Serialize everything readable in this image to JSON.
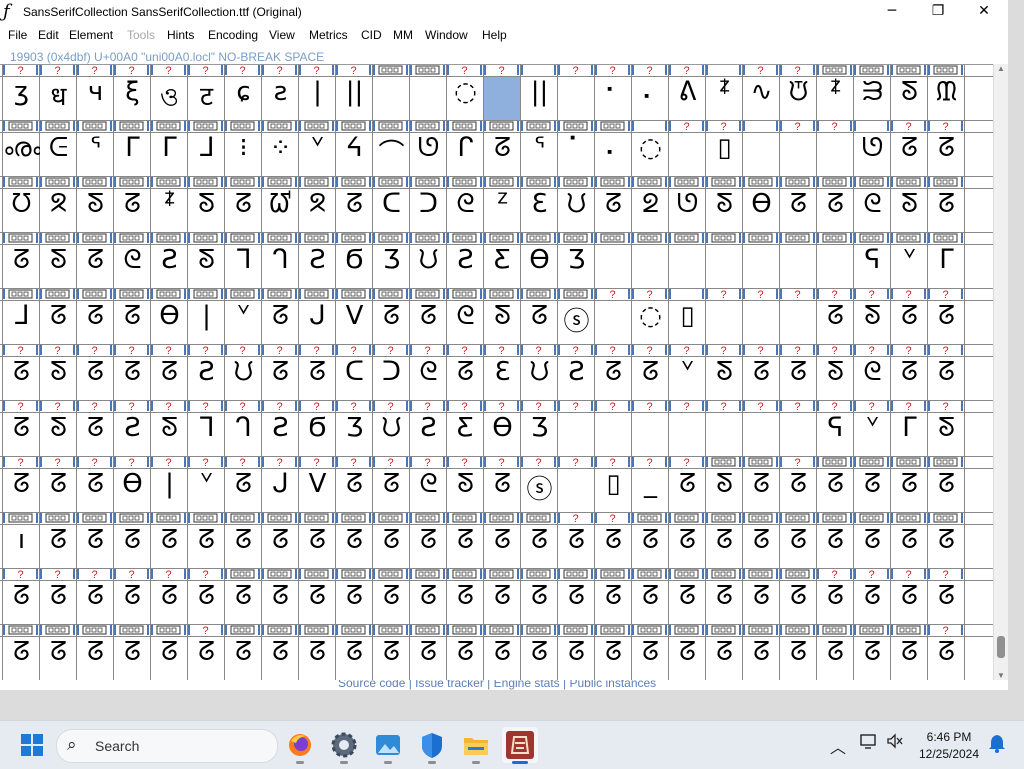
{
  "window": {
    "title": "SansSerifCollection  SansSerifCollection.ttf (Original)",
    "app_icon": "ƒ",
    "controls": {
      "minimize": "─",
      "maximize": "❐",
      "close": "✕"
    }
  },
  "menubar": [
    {
      "label": "File",
      "enabled": true
    },
    {
      "label": "Edit",
      "enabled": true
    },
    {
      "label": "Element",
      "enabled": true
    },
    {
      "label": "Tools",
      "enabled": false
    },
    {
      "label": "Hints",
      "enabled": true
    },
    {
      "label": "Encoding",
      "enabled": true
    },
    {
      "label": "View",
      "enabled": true
    },
    {
      "label": "Metrics",
      "enabled": true
    },
    {
      "label": "CID",
      "enabled": true
    },
    {
      "label": "MM",
      "enabled": true
    },
    {
      "label": "Window",
      "enabled": true
    },
    {
      "label": "Help",
      "enabled": true
    }
  ],
  "info_line": "19903 (0x4dbf) U+00A0 \"uni00A0.locl\" NO-BREAK SPACE",
  "glyph_grid": {
    "columns": 26,
    "selected_cell": {
      "row": 0,
      "col": 13
    },
    "rows": [
      {
        "labels": "??????????□□?? ???? ??□□□□□□□□□□□□□",
        "glyphs": [
          "ʒ",
          "ध",
          "ч",
          "ξ",
          "ও",
          "ट",
          "ɕ",
          "ƨ",
          "|",
          "||",
          "",
          "",
          "◌",
          "",
          "||",
          "",
          "⠂",
          "⠄",
          "ᕕ",
          "ᙇ",
          "∿",
          "ᙈ",
          "ᙇ",
          "ᙐ",
          "ᘕ",
          "ᙢ"
        ]
      },
      {
        "labels": "□□□□□□□□□□□□□□□□□ ?? ?? ???? □□□",
        "glyphs": [
          "ൟ",
          "ᕮ",
          "ᕐ",
          "ᒥ",
          "ᒥ",
          "ᒧ",
          "⁝",
          "⁘",
          "ᘁ",
          "ᔦ",
          "⌒",
          "ᘎ",
          "ᒋ",
          "ᘔ",
          "ᕐ",
          "⠁",
          "⠄",
          "◌",
          "",
          "▯",
          "",
          "",
          "",
          "ᘎ",
          "ᘔ",
          "ᘔ"
        ]
      },
      {
        "labels": "□□□□□□□□□□□□□□□□□□□□□□□□□□",
        "glyphs": [
          "ᘮ",
          "ᘝ",
          "ᘕ",
          "ᘔ",
          "ᙇ",
          "ᘕ",
          "ᘔ",
          "ᘺ",
          "ᘝ",
          "ᘔ",
          "ᑕ",
          "ᑐ",
          "ᘓ",
          "ᙆ",
          "Ɛ",
          "ᙀ",
          "ᘔ",
          "ᘖ",
          "ᘎ",
          "ᘕ",
          "Ɵ",
          "ᘔ",
          "ᘔ",
          "ᘓ",
          "ᘕ",
          "ᘔ"
        ]
      },
      {
        "labels": "□□□□□□□□□□□□□□□□□□□□□□□□□□",
        "glyphs": [
          "ᘔ",
          "ᘕ",
          "ᘔ",
          "ᘓ",
          "Ƨ",
          "ᘕ",
          "ᒣ",
          "ᒉ",
          "Ƨ",
          "Ϭ",
          "Ʒ",
          "ᙀ",
          "Ƨ",
          "Ƹ",
          "Ɵ",
          "Ʒ",
          "",
          "",
          "",
          "",
          "",
          "",
          "",
          "ᕋ",
          "ᘁ",
          "ᒥ"
        ]
      },
      {
        "labels": "□□□□□□□□□□□□□□□□?? ???????",
        "glyphs": [
          "ᒧ",
          "ᘔ",
          "ᘔ",
          "ᘔ",
          "Ɵ",
          "|",
          "ᘁ",
          "ᘔ",
          "ᒍ",
          "V",
          "ᘔ",
          "ᘔ",
          "ᘓ",
          "ᘕ",
          "ᘔ",
          "ⓢ",
          "",
          "◌",
          "▯",
          "",
          "",
          "",
          "ᘔ",
          "ᘕ",
          "ᘔ",
          "ᘔ"
        ]
      },
      {
        "labels": "??????????????????????????",
        "glyphs": [
          "ᘔ",
          "ᘕ",
          "ᘔ",
          "ᘔ",
          "ᘔ",
          "Ƨ",
          "ᙀ",
          "ᘔ",
          "ᘔ",
          "ᑕ",
          "ᑐ",
          "ᘓ",
          "ᘔ",
          "Ɛ",
          "ᙀ",
          "Ƨ",
          "ᘔ",
          "ᘔ",
          "ᘁ",
          "ᘕ",
          "ᘔ",
          "ᘔ",
          "ᘕ",
          "ᘓ",
          "ᘔ",
          "ᘔ"
        ]
      },
      {
        "labels": "??????????????????????????",
        "glyphs": [
          "ᘔ",
          "ᘕ",
          "ᘔ",
          "Ƨ",
          "ᘕ",
          "ᒣ",
          "ᒉ",
          "Ƨ",
          "Ϭ",
          "Ʒ",
          "ᙀ",
          "Ƨ",
          "Ƹ",
          "Ɵ",
          "Ʒ",
          "",
          "",
          "",
          "",
          "",
          "",
          "",
          "ᕋ",
          "ᘁ",
          "ᒥ",
          "ᘕ"
        ]
      },
      {
        "labels": "???????????????????□□?□□□□□",
        "glyphs": [
          "ᘔ",
          "ᘔ",
          "ᘔ",
          "Ɵ",
          "|",
          "ᘁ",
          "ᘔ",
          "ᒍ",
          "V",
          "ᘔ",
          "ᘔ",
          "ᘓ",
          "ᘕ",
          "ᘔ",
          "ⓢ",
          "",
          "▯",
          "_",
          "ᘔ",
          "ᘕ",
          "ᘔ",
          "ᘔ",
          "ᘔ",
          "ᘔ",
          "ᘔ",
          "ᘔ"
        ]
      },
      {
        "labels": "□□□□□□□□□□□□□□□??□□□□□□□□□",
        "glyphs": [
          "ı",
          "ᘔ",
          "ᘔ",
          "ᘔ",
          "ᘔ",
          "ᘔ",
          "ᘔ",
          "ᘔ",
          "ᘔ",
          "ᘔ",
          "ᘔ",
          "ᘔ",
          "ᘔ",
          "ᘔ",
          "ᘔ",
          "ᘔ",
          "ᘔ",
          "ᘔ",
          "ᘔ",
          "ᘔ",
          "ᘔ",
          "ᘔ",
          "ᘔ",
          "ᘔ",
          "ᘔ",
          "ᘔ"
        ]
      },
      {
        "labels": "??????□□□□□□□□□□□□□□□□????",
        "glyphs": [
          "ᘔ",
          "ᘔ",
          "ᘔ",
          "ᘔ",
          "ᘔ",
          "ᘔ",
          "ᘔ",
          "ᘔ",
          "ᘔ",
          "ᘔ",
          "ᘔ",
          "ᘔ",
          "ᘔ",
          "ᘔ",
          "ᘔ",
          "ᘔ",
          "ᘔ",
          "ᘔ",
          "ᘔ",
          "ᘔ",
          "ᘔ",
          "ᘔ",
          "ᘔ",
          "ᘔ",
          "ᘔ",
          "ᘔ"
        ]
      },
      {
        "labels": "□□□□□?□□□□□□□□□□□□□□□□□□□?",
        "glyphs": [
          "ᘔ",
          "ᘔ",
          "ᘔ",
          "ᘔ",
          "ᘔ",
          "ᘔ",
          "ᘔ",
          "ᘔ",
          "ᘔ",
          "ᘔ",
          "ᘔ",
          "ᘔ",
          "ᘔ",
          "ᘔ",
          "ᘔ",
          "ᘔ",
          "ᘔ",
          "ᘔ",
          "ᘔ",
          "ᘔ",
          "ᘔ",
          "ᘔ",
          "ᘔ",
          "ᘔ",
          "ᘔ",
          "ᘔ"
        ]
      }
    ]
  },
  "footer": {
    "links": "Source code | Issue tracker | Engine stats | Public instances"
  },
  "taskbar": {
    "search_label": "Search",
    "apps": [
      "firefox-icon",
      "settings-icon",
      "photos-icon",
      "security-icon",
      "file-explorer-icon",
      "fontforge-icon"
    ],
    "active_app": "fontforge-icon",
    "time": "6:46 PM",
    "date": "12/25/2024"
  },
  "colors": {
    "label_strip": "#4a76b8",
    "selected_cell": "#8fb0dc",
    "grid_line": "#000000",
    "info_text": "#7a9ec6",
    "question_mark": "#d02020"
  }
}
